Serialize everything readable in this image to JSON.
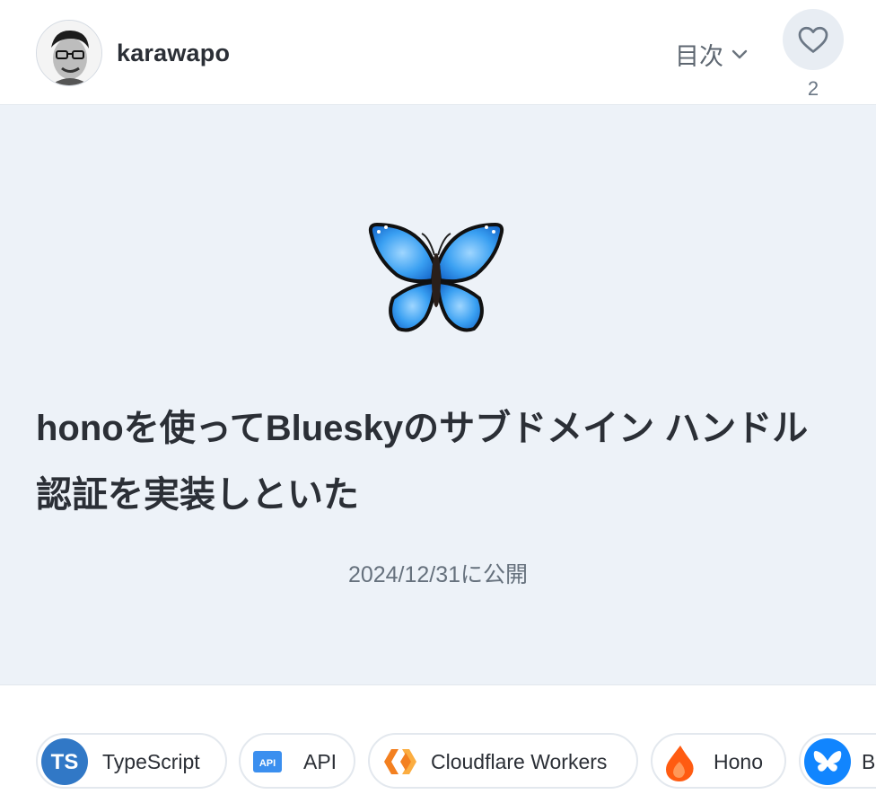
{
  "header": {
    "author_name": "karawapo",
    "toc_label": "目次",
    "like_count": "2"
  },
  "article": {
    "emoji": "butterfly",
    "title_line1": "honoを使ってBlueskyのサブドメイン ハンドル",
    "title_line2": "認証を実装しといた",
    "published": "2024/12/31に公開"
  },
  "topics": [
    {
      "label": "TypeScript",
      "icon": "typescript-icon",
      "icon_text": "TS"
    },
    {
      "label": "API",
      "icon": "api-icon",
      "icon_text": "API"
    },
    {
      "label": "Cloudflare Workers",
      "icon": "cloudflare-workers-icon"
    },
    {
      "label": "Hono",
      "icon": "hono-icon"
    },
    {
      "label": "B",
      "icon": "bluesky-icon"
    }
  ],
  "colors": {
    "hero_bg": "#edf2f8",
    "typescript": "#3178c6",
    "api": "#3b8fef",
    "cloudflare": "#f38020",
    "hono": "#ff5b11",
    "bluesky": "#1185fe"
  }
}
